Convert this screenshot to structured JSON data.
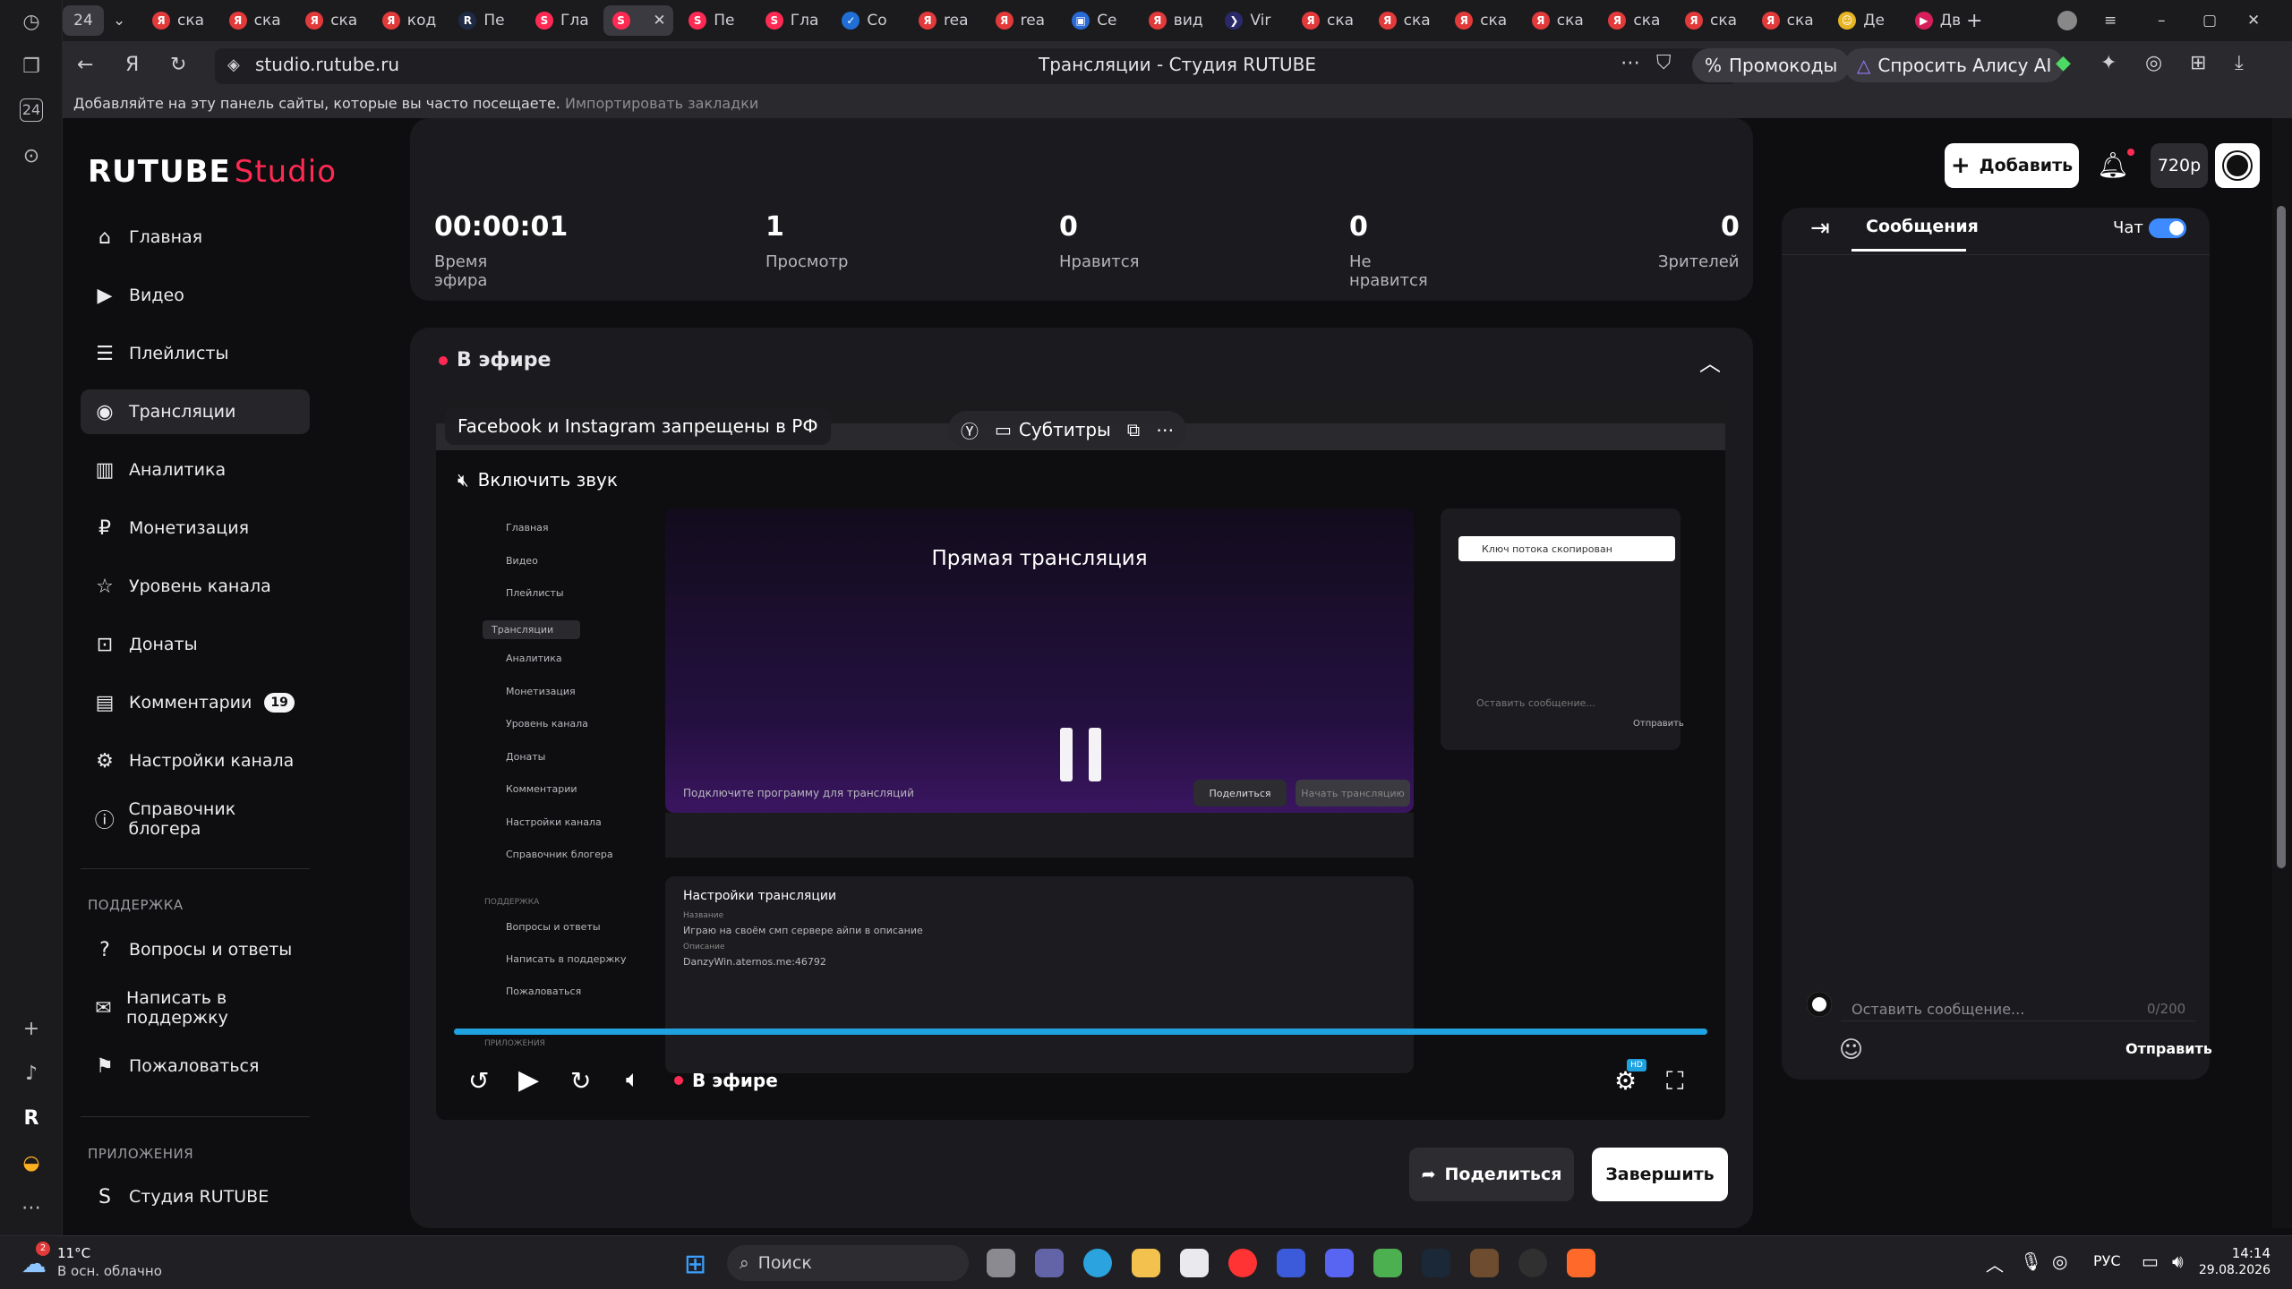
{
  "browser": {
    "tab_counter": "24",
    "tabs": [
      {
        "label": "ска",
        "fav": "Я",
        "color": "#e23a3a"
      },
      {
        "label": "ска",
        "fav": "Я",
        "color": "#e23a3a"
      },
      {
        "label": "ска",
        "fav": "Я",
        "color": "#e23a3a"
      },
      {
        "label": "код",
        "fav": "Я",
        "color": "#e23a3a"
      },
      {
        "label": "Пе",
        "fav": "R",
        "color": "#1f2a44"
      },
      {
        "label": "Гла",
        "fav": "S",
        "color": "#ff2a53"
      },
      {
        "label": "",
        "fav": "S",
        "color": "#ff2a53"
      },
      {
        "label": "Пе",
        "fav": "S",
        "color": "#ff2a53"
      },
      {
        "label": "Гла",
        "fav": "S",
        "color": "#ff2a53"
      },
      {
        "label": "Со",
        "fav": "✓",
        "color": "#1f6fd6"
      },
      {
        "label": "rea",
        "fav": "Я",
        "color": "#e23a3a"
      },
      {
        "label": "rea",
        "fav": "Я",
        "color": "#e23a3a"
      },
      {
        "label": "Се",
        "fav": "▣",
        "color": "#2a6ad6"
      },
      {
        "label": "вид",
        "fav": "Я",
        "color": "#e23a3a"
      },
      {
        "label": "Vir",
        "fav": "❯",
        "color": "#2a2a6a"
      },
      {
        "label": "ска",
        "fav": "Я",
        "color": "#e23a3a"
      },
      {
        "label": "ска",
        "fav": "Я",
        "color": "#e23a3a"
      },
      {
        "label": "ска",
        "fav": "Я",
        "color": "#e23a3a"
      },
      {
        "label": "ска",
        "fav": "Я",
        "color": "#e23a3a"
      },
      {
        "label": "ска",
        "fav": "Я",
        "color": "#e23a3a"
      },
      {
        "label": "ска",
        "fav": "Я",
        "color": "#e23a3a"
      },
      {
        "label": "ска",
        "fav": "Я",
        "color": "#e23a3a"
      },
      {
        "label": "Де",
        "fav": "☺",
        "color": "#e6b422"
      },
      {
        "label": "Дв",
        "fav": "▶",
        "color": "#d61f5a"
      }
    ],
    "url": "studio.rutube.ru",
    "page_title": "Трансляции - Студия RUTUBE",
    "promo_label": "Промокоды",
    "alice_label": "Спросить Алису AI",
    "bookmarks_hint": "Добавляйте на эту панель сайты, которые вы часто посещаете.",
    "bookmarks_import": "Импортировать закладки"
  },
  "app": {
    "logo_main": "RUTUBE",
    "logo_studio": "Studio",
    "add_button": "Добавить",
    "quality_label": "720p",
    "nav": [
      {
        "label": "Главная",
        "icon": "home-icon",
        "glyph": "⌂"
      },
      {
        "label": "Видео",
        "icon": "video-icon",
        "glyph": "▶"
      },
      {
        "label": "Плейлисты",
        "icon": "playlist-icon",
        "glyph": "☰"
      },
      {
        "label": "Трансляции",
        "icon": "broadcast-icon",
        "glyph": "◉"
      },
      {
        "label": "Аналитика",
        "icon": "analytics-icon",
        "glyph": "▥"
      },
      {
        "label": "Монетизация",
        "icon": "monetization-icon",
        "glyph": "₽"
      },
      {
        "label": "Уровень канала",
        "icon": "star-icon",
        "glyph": "☆"
      },
      {
        "label": "Донаты",
        "icon": "donate-icon",
        "glyph": "⊡"
      },
      {
        "label": "Комментарии",
        "icon": "comment-icon",
        "glyph": "▤",
        "badge": "19"
      },
      {
        "label": "Настройки канала",
        "icon": "gear-icon",
        "glyph": "⚙"
      },
      {
        "label": "Справочник блогера",
        "icon": "info-icon",
        "glyph": "ⓘ"
      }
    ],
    "support_title": "ПОДДЕРЖКА",
    "support": [
      {
        "label": "Вопросы и ответы",
        "icon": "help-icon",
        "glyph": "?"
      },
      {
        "label": "Написать в поддержку",
        "icon": "mail-icon",
        "glyph": "✉"
      },
      {
        "label": "Пожаловаться",
        "icon": "flag-icon",
        "glyph": "⚑"
      }
    ],
    "apps_title": "ПРИЛОЖЕНИЯ",
    "apps": [
      {
        "label": "Студия RUTUBE",
        "icon": "studio-app-icon",
        "glyph": "S"
      }
    ]
  },
  "stats": [
    {
      "value": "00:00:01",
      "label": "Время эфира"
    },
    {
      "value": "1",
      "label": "Просмотр"
    },
    {
      "value": "0",
      "label": "Нравится"
    },
    {
      "value": "0",
      "label": "Не нравится"
    },
    {
      "value": "0",
      "label": "Зрителей"
    }
  ],
  "live": {
    "title": "В эфире",
    "player": {
      "notice": "Facebook и Instagram запрещены в РФ",
      "subtitles": "Субтитры",
      "unmute": "Включить звук",
      "stream_heading": "Прямая трансляция",
      "live_label": "В эфире",
      "progress": 1.0,
      "inner_nav": [
        "Главная",
        "Видео",
        "Плейлисты",
        "Трансляции",
        "Аналитика",
        "Монетизация",
        "Уровень канала",
        "Донаты",
        "Комментарии",
        "Настройки канала",
        "Справочник блогера"
      ],
      "inner_support": "ПОДДЕРЖКА",
      "inner_support_items": [
        "Вопросы и ответы",
        "Написать в поддержку",
        "Пожаловаться"
      ],
      "inner_apps": "ПРИЛОЖЕНИЯ",
      "inner_notice": "Подключите программу для трансляций",
      "inner_share": "Поделиться",
      "inner_start": "Начать трансляцию",
      "inner_settings": "Настройки трансляции",
      "inner_name_label": "Название",
      "inner_name": "Играю на своём смп сервере айпи в описание",
      "inner_desc_label": "Описание",
      "inner_desc": "DanzyWin.aternos.me:46792",
      "inner_key_copied": "Ключ потока скопирован",
      "inner_chat_placeholder": "Оставить сообщение...",
      "inner_send": "Отправить"
    },
    "share_button": "Поделиться",
    "finish_button": "Завершить"
  },
  "chat": {
    "tab_messages": "Сообщения",
    "chat_toggle_label": "Чат",
    "chat_enabled": true,
    "placeholder": "Оставить сообщение...",
    "counter": "0/200",
    "send": "Отправить"
  },
  "taskbar": {
    "weather_temp": "11°C",
    "weather_desc": "В осн. облачно",
    "weather_badge": "2",
    "search_placeholder": "Поиск",
    "lang": "РУС",
    "time": "14:14",
    "date": "29.08.2026"
  }
}
